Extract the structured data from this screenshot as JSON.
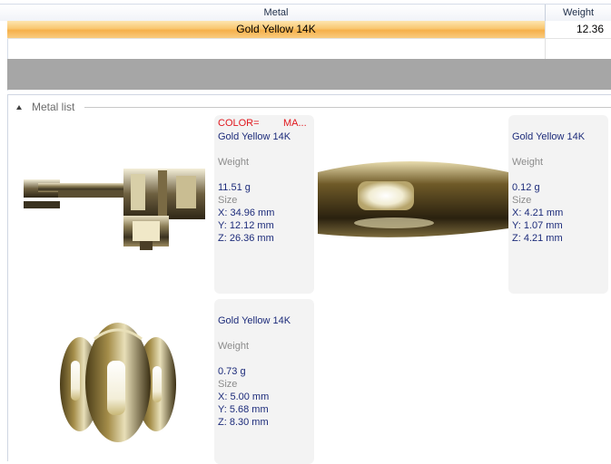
{
  "grid": {
    "columns": {
      "metal": "Metal",
      "weight": "Weight"
    },
    "rows": [
      {
        "metal": "Gold Yellow 14K",
        "weight": "12.36"
      }
    ]
  },
  "section": {
    "title": "Metal list"
  },
  "cards": [
    {
      "color_label": "COLOR=",
      "material_label": "MA...",
      "metal": "Gold Yellow 14K",
      "weight_label": "Weight",
      "weight": "11.51 g",
      "size_label": "Size",
      "x": "X: 34.96 mm",
      "y": "Y: 12.12 mm",
      "z": "Z: 26.36 mm",
      "image": "mechanical-clasp-part-image"
    },
    {
      "metal": "Gold Yellow 14K",
      "weight_label": "Weight",
      "weight": "0.12 g",
      "size_label": "Size",
      "x": "X: 4.21 mm",
      "y": "Y: 1.07 mm",
      "z": "Z: 4.21 mm",
      "image": "gold-band-segment-image"
    },
    {
      "metal": "Gold Yellow 14K",
      "weight_label": "Weight",
      "weight": "0.73 g",
      "size_label": "Size",
      "x": "X: 5.00 mm",
      "y": "Y: 5.68 mm",
      "z": "Z: 8.30 mm",
      "image": "gold-bead-image"
    }
  ],
  "colors": {
    "selection": "#f6b04a",
    "navy": "#1c2b7a",
    "red": "#e0171d",
    "band": "#a6a6a6"
  }
}
